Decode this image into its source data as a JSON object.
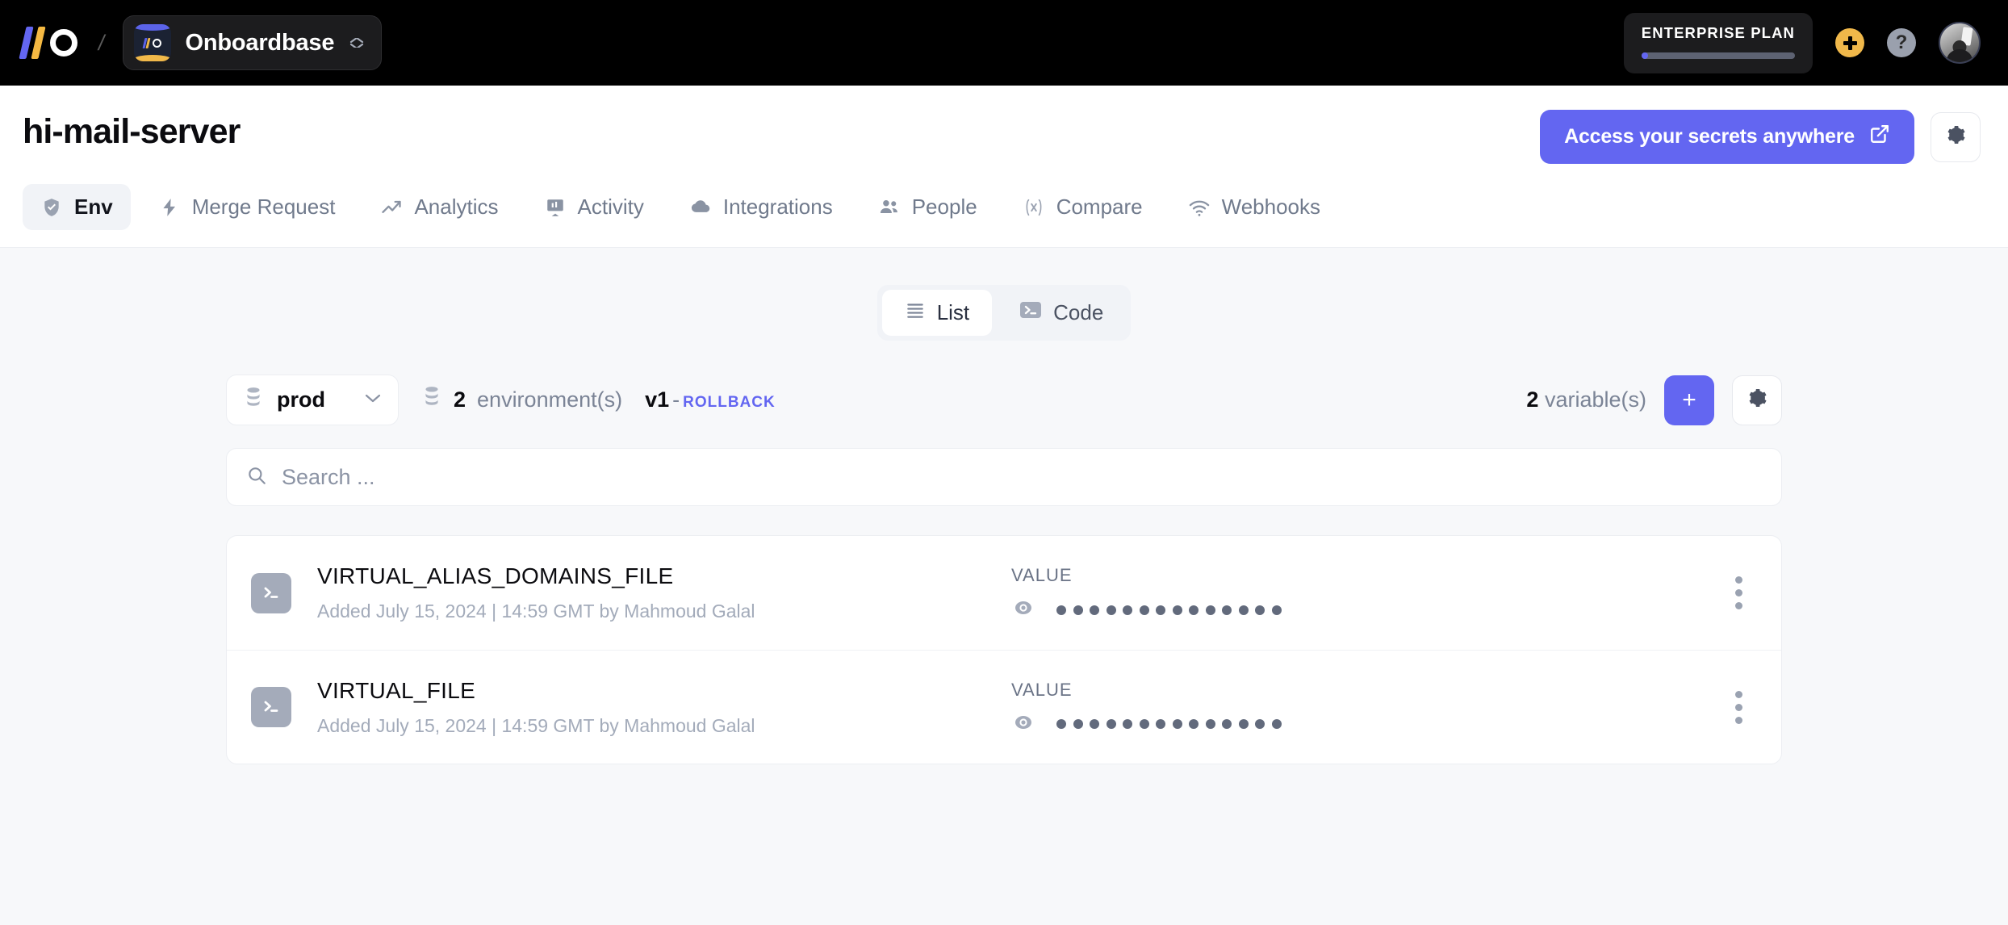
{
  "topbar": {
    "brand_logo": "onboardbase-logo",
    "separator": "/",
    "org_name": "Onboardbase",
    "plan_label": "ENTERPRISE PLAN",
    "add_icon": "plus-icon",
    "help_icon": "question-icon",
    "avatar": "user-avatar",
    "accent_amber": "#f0b84a",
    "accent_indigo": "#6366f1"
  },
  "page": {
    "title": "hi-mail-server",
    "cta_label": "Access your secrets anywhere",
    "cta_icon": "external-link-icon",
    "settings_icon": "gear-icon"
  },
  "tabs": [
    {
      "label": "Env",
      "icon": "shield-check-icon",
      "active": true
    },
    {
      "label": "Merge Request",
      "icon": "bolt-icon",
      "active": false
    },
    {
      "label": "Analytics",
      "icon": "trend-up-icon",
      "active": false
    },
    {
      "label": "Activity",
      "icon": "presentation-chart-icon",
      "active": false
    },
    {
      "label": "Integrations",
      "icon": "cloud-icon",
      "active": false
    },
    {
      "label": "People",
      "icon": "users-icon",
      "active": false
    },
    {
      "label": "Compare",
      "icon": "variable-icon",
      "active": false
    },
    {
      "label": "Webhooks",
      "icon": "wifi-icon",
      "active": false
    }
  ],
  "view_toggle": [
    {
      "label": "List",
      "icon": "list-icon",
      "active": true
    },
    {
      "label": "Code",
      "icon": "terminal-icon",
      "active": false
    }
  ],
  "toolbar": {
    "environment": "prod",
    "environment_icon": "database-stack-icon",
    "chevron_icon": "chevron-down-icon",
    "environments_count": "2",
    "environments_suffix": "environment(s)",
    "environments_icon": "database-stack-icon",
    "version": "v1",
    "version_dash": "-",
    "rollback_label": "ROLLBACK",
    "variables_count": "2",
    "variables_suffix": "variable(s)",
    "add_label": "+",
    "settings_icon": "gear-icon"
  },
  "search": {
    "placeholder": "Search ...",
    "value": "",
    "icon": "search-icon"
  },
  "variables": {
    "value_column_label": "VALUE",
    "mask_dot_count": 14,
    "rows": [
      {
        "icon": "terminal-icon",
        "name": "VIRTUAL_ALIAS_DOMAINS_FILE",
        "meta": "Added July 15, 2024 | 14:59 GMT by Mahmoud Galal",
        "value_label": "VALUE",
        "reveal_icon": "eye-icon",
        "menu_icon": "kebab-menu-icon"
      },
      {
        "icon": "terminal-icon",
        "name": "VIRTUAL_FILE",
        "meta": "Added July 15, 2024 | 14:59 GMT by Mahmoud Galal",
        "value_label": "VALUE",
        "reveal_icon": "eye-icon",
        "menu_icon": "kebab-menu-icon"
      }
    ]
  }
}
